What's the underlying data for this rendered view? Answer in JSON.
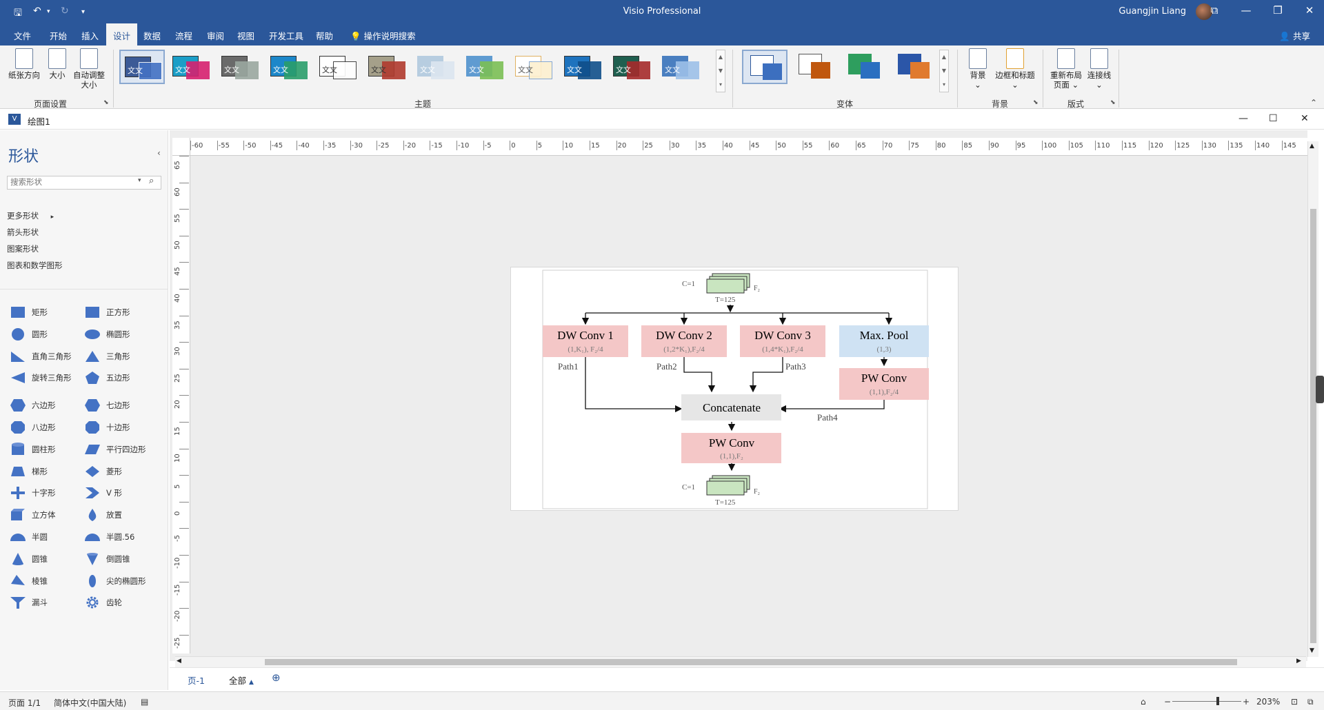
{
  "title_bar": {
    "app_title": "Visio Professional",
    "user_name": "Guangjin Liang",
    "window_controls": [
      "minimize-icon",
      "restore-icon",
      "close-icon"
    ],
    "ribbon_display_icon": "ribbon-display-icon"
  },
  "menu": {
    "items": [
      "文件",
      "开始",
      "插入",
      "设计",
      "数据",
      "流程",
      "审阅",
      "视图",
      "开发工具",
      "帮助"
    ],
    "active": "设计",
    "tell_me": "操作说明搜索",
    "share": "共享"
  },
  "ribbon": {
    "page_setup": {
      "buttons": [
        "纸张方向",
        "大小",
        "自动调整大小"
      ],
      "group": "页面设置"
    },
    "themes": {
      "label": "文文",
      "group": "主题"
    },
    "variants": {
      "group": "变体"
    },
    "background": {
      "buttons": [
        "背景",
        "边框和标题"
      ],
      "group": "背景"
    },
    "layout": {
      "buttons": [
        "重新布局页面",
        "连接线"
      ],
      "group": "版式"
    }
  },
  "document": {
    "title": "绘图1"
  },
  "shapes_panel": {
    "title": "形状",
    "search_placeholder": "搜索形状",
    "stencils": [
      "更多形状",
      "箭头形状",
      "图案形状",
      "图表和数学图形"
    ],
    "shapes": [
      {
        "left": "矩形",
        "right": "正方形"
      },
      {
        "left": "圆形",
        "right": "椭圆形"
      },
      {
        "left": "直角三角形",
        "right": "三角形"
      },
      {
        "left": "旋转三角形",
        "right": "五边形"
      },
      {
        "left": "六边形",
        "right": "七边形"
      },
      {
        "left": "八边形",
        "right": "十边形"
      },
      {
        "left": "圆柱形",
        "right": "平行四边形"
      },
      {
        "left": "梯形",
        "right": "菱形"
      },
      {
        "left": "十字形",
        "right": "V 形"
      },
      {
        "left": "立方体",
        "right": "放置"
      },
      {
        "left": "半圆",
        "right": "半圆.56"
      },
      {
        "left": "圆锥",
        "right": "倒圆锥"
      },
      {
        "left": "棱锥",
        "right": "尖的椭圆形"
      },
      {
        "left": "漏斗",
        "right": "齿轮"
      }
    ]
  },
  "rulers": {
    "h_ticks": [
      "-60",
      "-55",
      "-50",
      "-45",
      "-40",
      "-35",
      "-30",
      "-25",
      "-20",
      "-15",
      "-10",
      "-5",
      "0",
      "5",
      "10",
      "15",
      "20",
      "25",
      "30",
      "35",
      "40",
      "45",
      "50",
      "55",
      "60",
      "65",
      "70",
      "75",
      "80",
      "85",
      "90",
      "95",
      "100",
      "105",
      "110",
      "115",
      "120",
      "125",
      "130",
      "135",
      "140",
      "145"
    ],
    "v_ticks": [
      "65",
      "60",
      "55",
      "50",
      "45",
      "40",
      "35",
      "30",
      "25",
      "20",
      "15",
      "10",
      "5",
      "0",
      "-5",
      "-10",
      "-15",
      "-20",
      "-25"
    ]
  },
  "diagram": {
    "input": {
      "c": "C=1",
      "f": "F₂",
      "t": "T=125"
    },
    "branches": [
      {
        "title": "DW Conv 1",
        "params": "(1,K₁), F₂/4",
        "path": "Path1",
        "color": "#f4c7c7"
      },
      {
        "title": "DW Conv 2",
        "params": "(1,2*K₁),F₂/4",
        "path": "Path2",
        "color": "#f4c7c7"
      },
      {
        "title": "DW Conv 3",
        "params": "(1,4*K₁),F₂/4",
        "path": "Path3",
        "color": "#f4c7c7"
      },
      {
        "title": "Max. Pool",
        "params": "(1,3)",
        "path": "",
        "color": "#cfe2f3"
      }
    ],
    "pw_branch": {
      "title": "PW Conv",
      "params": "(1,1),F₂/4",
      "path": "Path4"
    },
    "concat": {
      "title": "Concatenate"
    },
    "pw_final": {
      "title": "PW Conv",
      "params": "(1,1),F₂"
    },
    "output": {
      "c": "C=1",
      "f": "F₂",
      "t": "T=125"
    }
  },
  "bottom_tabs": {
    "page": "页-1",
    "all": "全部",
    "add_icon": "plus-circle-icon"
  },
  "status_bar": {
    "page": "页面 1/1",
    "language": "简体中文(中国大陆)",
    "zoom": "203%"
  }
}
